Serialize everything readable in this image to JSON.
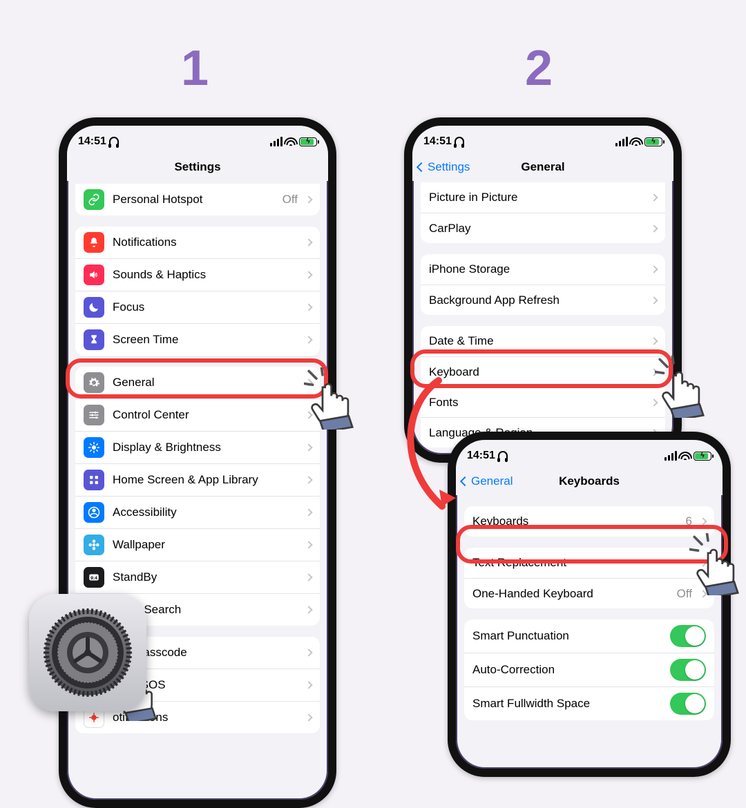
{
  "steps": {
    "one": "1",
    "two": "2"
  },
  "status": {
    "time": "14:51"
  },
  "colors": {
    "green": "#34c759",
    "red": "#ff3b30",
    "pink": "#ff2d55",
    "indigo": "#5856d6",
    "blue": "#007aff",
    "cyan": "#32ade6",
    "gray": "#8e8e93",
    "black": "#1c1c1e",
    "orange": "#ff9500"
  },
  "phone1": {
    "title": "Settings",
    "hotspot": {
      "label": "Personal Hotspot",
      "value": "Off"
    },
    "g2": [
      {
        "key": "notifications",
        "label": "Notifications",
        "icon": "bell",
        "bg": "red"
      },
      {
        "key": "sounds",
        "label": "Sounds & Haptics",
        "icon": "speaker",
        "bg": "pink"
      },
      {
        "key": "focus",
        "label": "Focus",
        "icon": "moon",
        "bg": "indigo"
      },
      {
        "key": "screentime",
        "label": "Screen Time",
        "icon": "hourglass",
        "bg": "indigo"
      }
    ],
    "g3": [
      {
        "key": "general",
        "label": "General",
        "icon": "gear",
        "bg": "gray"
      },
      {
        "key": "controlcenter",
        "label": "Control Center",
        "icon": "sliders",
        "bg": "gray"
      },
      {
        "key": "display",
        "label": "Display & Brightness",
        "icon": "sun",
        "bg": "blue"
      },
      {
        "key": "homescreen",
        "label": "Home Screen & App Library",
        "icon": "grid",
        "bg": "indigo"
      },
      {
        "key": "accessibility",
        "label": "Accessibility",
        "icon": "person",
        "bg": "blue"
      },
      {
        "key": "wallpaper",
        "label": "Wallpaper",
        "icon": "flower",
        "bg": "cyan"
      },
      {
        "key": "standby",
        "label": "StandBy",
        "icon": "clock",
        "bg": "black"
      },
      {
        "key": "siri",
        "label": "Siri & Search",
        "icon": "siri",
        "bg": "black"
      }
    ],
    "g3b": [
      {
        "key": "faceid",
        "label_full": "Face ID & Passcode",
        "icon": "faceid",
        "bg": "green"
      },
      {
        "key": "sos",
        "label_full": "Emergency SOS",
        "icon": "sos",
        "bg": "red"
      },
      {
        "key": "exposure",
        "label_full": "Exposure Notifications",
        "icon": "virus",
        "bg": "white"
      }
    ],
    "faceid_cut": "D & Passcode",
    "sos_cut": "ency SOS",
    "exposure_cut": "otifications"
  },
  "phone2": {
    "back": "Settings",
    "title": "General",
    "g1": [
      "Picture in Picture",
      "CarPlay"
    ],
    "g2": [
      "iPhone Storage",
      "Background App Refresh"
    ],
    "g3": [
      "Date & Time",
      "Keyboard",
      "Fonts",
      "Language & Region"
    ]
  },
  "phone3": {
    "back": "General",
    "title": "Keyboards",
    "keyboards_label": "Keyboards",
    "keyboards_count": "6",
    "g2": [
      {
        "label": "Text Replacement"
      },
      {
        "label": "One-Handed Keyboard",
        "value": "Off"
      }
    ],
    "g3": [
      "Smart Punctuation",
      "Auto-Correction",
      "Smart Fullwidth Space"
    ]
  }
}
